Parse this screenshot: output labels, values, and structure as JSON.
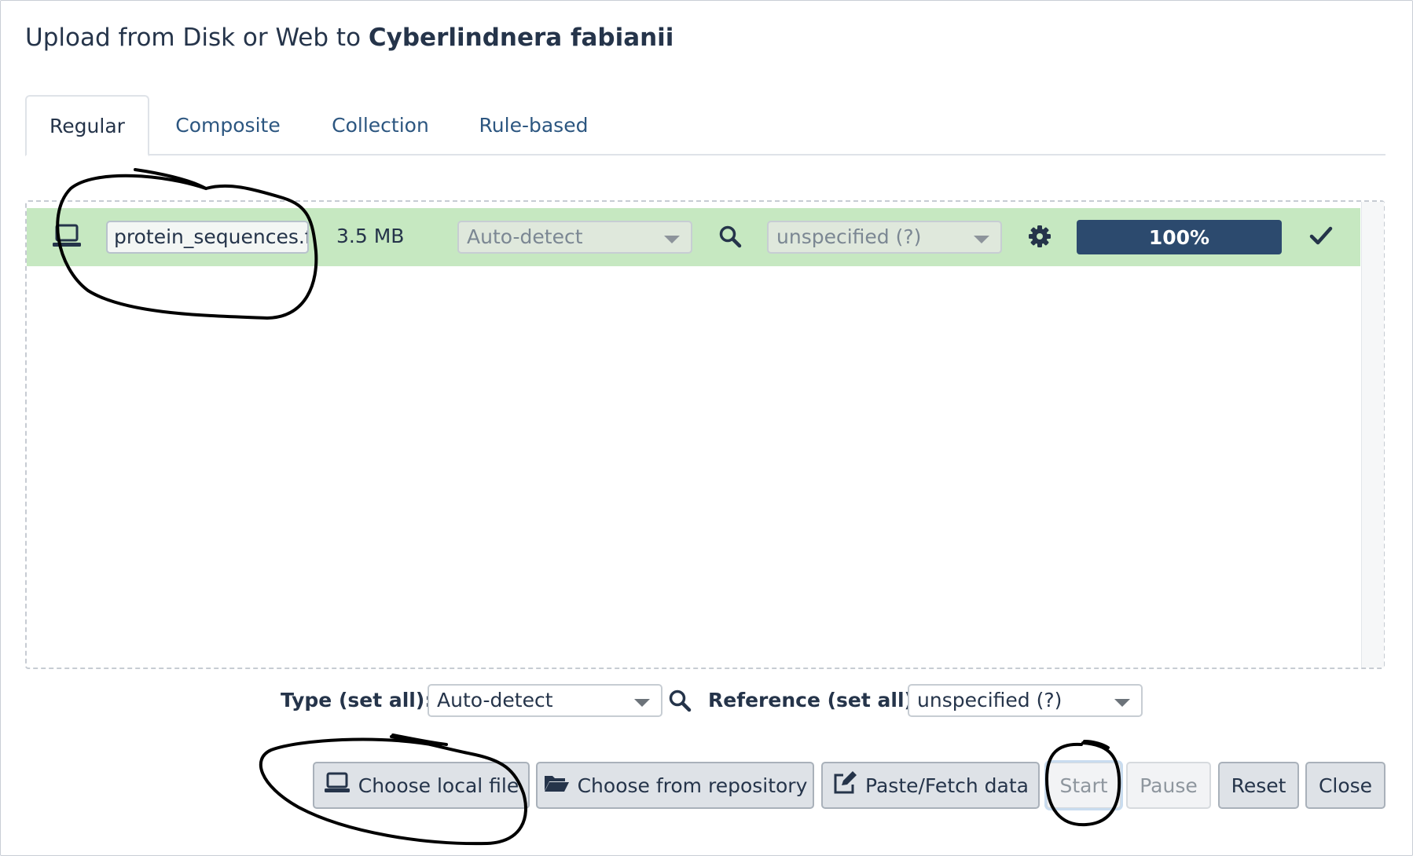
{
  "dialog": {
    "title_prefix": "Upload from Disk or Web to ",
    "title_history": "Cyberlindnera fabianii"
  },
  "tabs": [
    {
      "label": "Regular",
      "active": true
    },
    {
      "label": "Composite",
      "active": false
    },
    {
      "label": "Collection",
      "active": false
    },
    {
      "label": "Rule-based",
      "active": false
    }
  ],
  "upload_row": {
    "source_icon": "laptop-icon",
    "file_name": "protein_sequences.fasta",
    "size": "3.5 MB",
    "type": "Auto-detect",
    "reference": "unspecified (?)",
    "progress_label": "100%",
    "progress_fraction": 1.0,
    "status_icon": "check-icon",
    "row_color": "#c6e8c1"
  },
  "set_all": {
    "type_label": "Type (set all):",
    "type_value": "Auto-detect",
    "reference_label": "Reference (set all):",
    "reference_value": "unspecified (?)"
  },
  "buttons": {
    "choose_local": "Choose local file",
    "choose_repo": "Choose from repository",
    "paste_fetch": "Paste/Fetch data",
    "start": "Start",
    "pause": "Pause",
    "reset": "Reset",
    "close": "Close"
  },
  "colors": {
    "accent": "#2c4a6e",
    "link": "#2c5680",
    "success_row": "#c6e8c1"
  }
}
